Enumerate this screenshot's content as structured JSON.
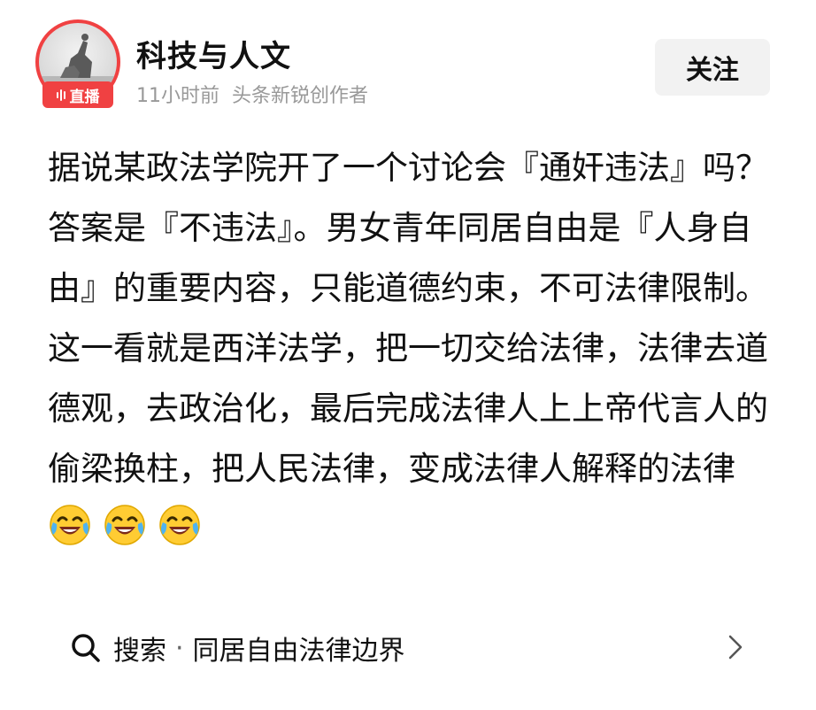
{
  "author": {
    "name": "科技与人文",
    "live_label": "直播",
    "time": "11小时前",
    "role": "头条新锐创作者"
  },
  "follow": {
    "label": "关注"
  },
  "post": {
    "paragraph1": "据说某政法学院开了一个讨论会『通奸违法』吗？答案是『不违法』。男女青年同居自由是『人身自由』的重要内容，只能道德约束，不可法律限制。",
    "paragraph2": "这一看就是西洋法学，把一切交给法律，法律去道德观，去政治化，最后完成法律人上上帝代言人的偷梁换柱，把人民法律，变成法律人解释的法律",
    "emojis": [
      "laughing-crying-emoji",
      "laughing-crying-emoji",
      "laughing-crying-emoji"
    ]
  },
  "search": {
    "label": "搜索",
    "separator": "·",
    "term": "同居自由法律边界"
  },
  "colors": {
    "accent_red": "#f04142",
    "meta_gray": "#999999",
    "button_bg": "#f2f2f2"
  }
}
